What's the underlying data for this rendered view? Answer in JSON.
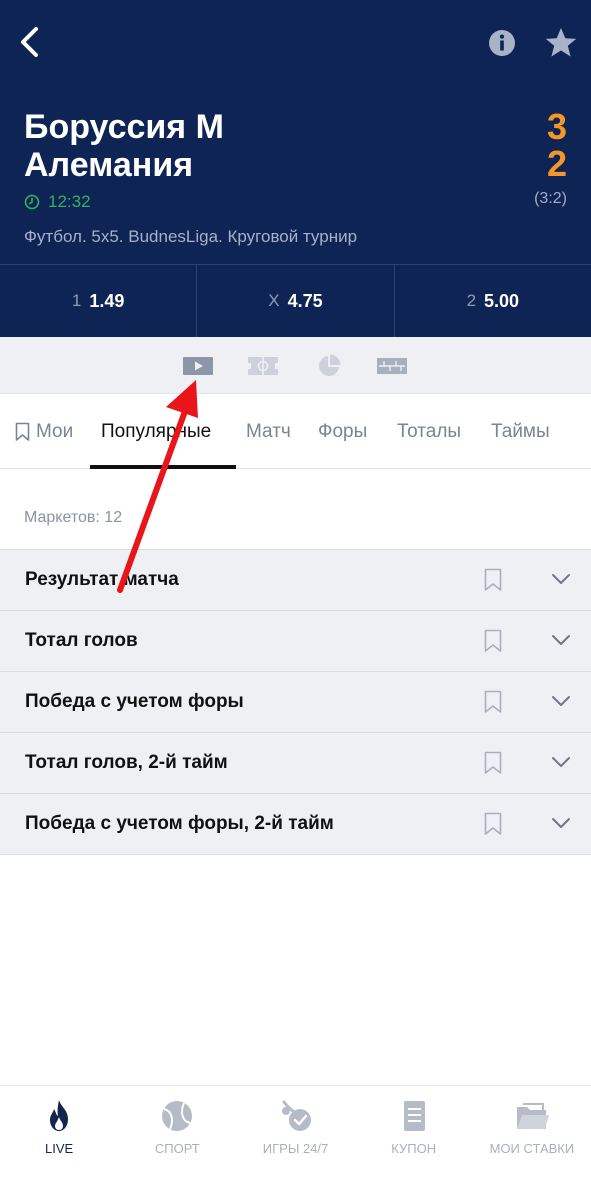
{
  "match": {
    "team1": "Боруссия М",
    "team2": "Алемания",
    "score1": "3",
    "score2": "2",
    "time": "12:32",
    "half_score": "(3:2)",
    "league": "Футбол. 5x5. BudnesLiga. Круговой турнир"
  },
  "odds": [
    {
      "key": "1",
      "value": "1.49"
    },
    {
      "key": "X",
      "value": "4.75"
    },
    {
      "key": "2",
      "value": "5.00"
    }
  ],
  "tabs": [
    {
      "label": "Мои"
    },
    {
      "label": "Популярные"
    },
    {
      "label": "Матч"
    },
    {
      "label": "Форы"
    },
    {
      "label": "Тоталы"
    },
    {
      "label": "Таймы"
    }
  ],
  "markets_count": "Маркетов: 12",
  "markets": [
    {
      "title": "Результат матча"
    },
    {
      "title": "Тотал голов"
    },
    {
      "title": "Победа с учетом форы"
    },
    {
      "title": "Тотал голов, 2-й тайм"
    },
    {
      "title": "Победа с учетом форы, 2-й тайм"
    }
  ],
  "nav": [
    {
      "label": "LIVE",
      "icon": "fire-icon"
    },
    {
      "label": "СПОРТ",
      "icon": "tennis-ball-icon"
    },
    {
      "label": "ИГРЫ 24/7",
      "icon": "games-icon"
    },
    {
      "label": "КУПОН",
      "icon": "coupon-icon"
    },
    {
      "label": "МОИ СТАВКИ",
      "icon": "folder-icon"
    }
  ],
  "colors": {
    "header_bg": "#0e2454",
    "score": "#f5962a",
    "time": "#2fb35d",
    "arrow": "#e8151b"
  }
}
